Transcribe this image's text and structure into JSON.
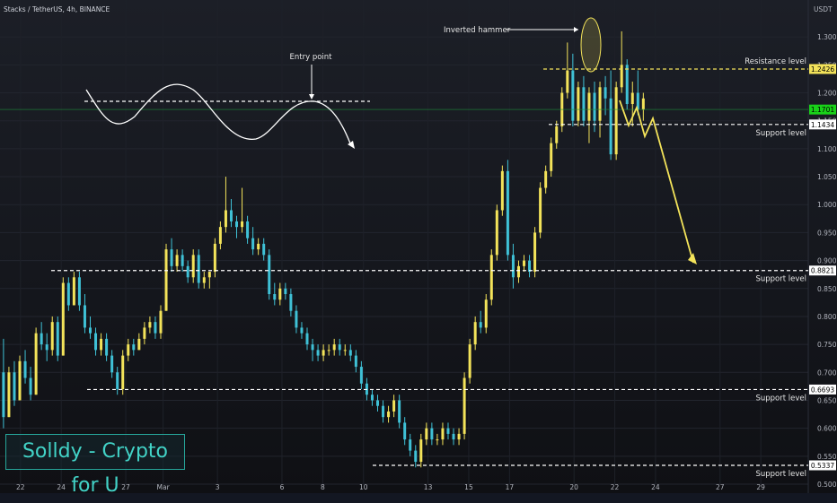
{
  "header": {
    "symbol_line": "Stacks / TetherUS, 4h, BINANCE",
    "quote_currency": "USDT"
  },
  "watermark": "Solldy - Crypto for U",
  "colors": {
    "bull": "#f3e35a",
    "bear": "#3fc1d6",
    "level_line": "#ffffff",
    "resistance_line": "#f3e35a",
    "projection": "#f3e35a",
    "price_tag": "#19d219",
    "background": "#131722"
  },
  "chart_data": {
    "type": "candlestick",
    "timeframe": "4h",
    "ylim": [
      0.5,
      1.35
    ],
    "y_ticks": [
      1.3,
      1.25,
      1.2,
      1.15,
      1.1,
      1.05,
      1.0,
      0.95,
      0.9,
      0.85,
      0.8,
      0.75,
      0.7,
      0.65,
      0.6,
      0.55,
      0.5
    ],
    "y_tick_labels": [
      "1.3000",
      "1.2500",
      "1.2000",
      "1.1500",
      "1.1000",
      "1.0500",
      "1.0000",
      "0.9500",
      "0.9000",
      "0.8500",
      "0.8000",
      "0.7500",
      "0.7000",
      "0.6500",
      "0.6000",
      "0.5500",
      "0.5000"
    ],
    "x_labels": [
      "22",
      "24",
      "27",
      "Mar",
      "3",
      "6",
      "8",
      "10",
      "13",
      "15",
      "17",
      "20",
      "22",
      "24",
      "27",
      "29"
    ],
    "x_label_index": [
      5,
      17,
      36,
      47,
      63,
      82,
      94,
      106,
      125,
      137,
      149,
      168,
      180,
      192,
      211,
      223
    ],
    "x_total_slots": 238,
    "candles": [
      [
        0.7,
        0.76,
        0.6,
        0.62
      ],
      [
        0.62,
        0.71,
        0.62,
        0.7
      ],
      [
        0.7,
        0.72,
        0.64,
        0.65
      ],
      [
        0.65,
        0.73,
        0.65,
        0.72
      ],
      [
        0.72,
        0.74,
        0.68,
        0.69
      ],
      [
        0.69,
        0.71,
        0.65,
        0.66
      ],
      [
        0.66,
        0.78,
        0.66,
        0.77
      ],
      [
        0.77,
        0.79,
        0.74,
        0.75
      ],
      [
        0.75,
        0.77,
        0.72,
        0.74
      ],
      [
        0.74,
        0.8,
        0.73,
        0.79
      ],
      [
        0.79,
        0.8,
        0.72,
        0.73
      ],
      [
        0.73,
        0.87,
        0.73,
        0.86
      ],
      [
        0.86,
        0.87,
        0.81,
        0.82
      ],
      [
        0.82,
        0.88,
        0.82,
        0.87
      ],
      [
        0.87,
        0.88,
        0.81,
        0.82
      ],
      [
        0.82,
        0.84,
        0.77,
        0.78
      ],
      [
        0.78,
        0.8,
        0.76,
        0.77
      ],
      [
        0.77,
        0.78,
        0.73,
        0.74
      ],
      [
        0.74,
        0.77,
        0.73,
        0.76
      ],
      [
        0.76,
        0.77,
        0.72,
        0.73
      ],
      [
        0.73,
        0.74,
        0.69,
        0.7
      ],
      [
        0.7,
        0.71,
        0.66,
        0.67
      ],
      [
        0.67,
        0.74,
        0.66,
        0.73
      ],
      [
        0.73,
        0.76,
        0.72,
        0.75
      ],
      [
        0.75,
        0.76,
        0.73,
        0.74
      ],
      [
        0.74,
        0.77,
        0.74,
        0.76
      ],
      [
        0.76,
        0.79,
        0.75,
        0.78
      ],
      [
        0.78,
        0.8,
        0.77,
        0.79
      ],
      [
        0.79,
        0.8,
        0.76,
        0.77
      ],
      [
        0.77,
        0.82,
        0.76,
        0.81
      ],
      [
        0.81,
        0.93,
        0.81,
        0.92
      ],
      [
        0.92,
        0.94,
        0.88,
        0.89
      ],
      [
        0.89,
        0.92,
        0.88,
        0.91
      ],
      [
        0.91,
        0.92,
        0.88,
        0.89
      ],
      [
        0.89,
        0.9,
        0.86,
        0.87
      ],
      [
        0.87,
        0.92,
        0.86,
        0.91
      ],
      [
        0.91,
        0.92,
        0.85,
        0.86
      ],
      [
        0.86,
        0.88,
        0.85,
        0.87
      ],
      [
        0.87,
        0.88,
        0.85,
        0.88
      ],
      [
        0.88,
        0.94,
        0.87,
        0.93
      ],
      [
        0.93,
        0.97,
        0.92,
        0.96
      ],
      [
        0.96,
        1.05,
        0.95,
        0.99
      ],
      [
        0.99,
        1.01,
        0.96,
        0.97
      ],
      [
        0.97,
        0.98,
        0.94,
        0.96
      ],
      [
        0.96,
        1.03,
        0.95,
        0.97
      ],
      [
        0.97,
        0.98,
        0.93,
        0.94
      ],
      [
        0.94,
        0.96,
        0.91,
        0.92
      ],
      [
        0.92,
        0.94,
        0.91,
        0.93
      ],
      [
        0.93,
        0.94,
        0.9,
        0.91
      ],
      [
        0.91,
        0.92,
        0.83,
        0.84
      ],
      [
        0.84,
        0.86,
        0.82,
        0.83
      ],
      [
        0.83,
        0.86,
        0.82,
        0.85
      ],
      [
        0.85,
        0.86,
        0.83,
        0.84
      ],
      [
        0.84,
        0.85,
        0.8,
        0.81
      ],
      [
        0.81,
        0.82,
        0.77,
        0.78
      ],
      [
        0.78,
        0.79,
        0.76,
        0.77
      ],
      [
        0.77,
        0.78,
        0.74,
        0.75
      ],
      [
        0.75,
        0.76,
        0.72,
        0.74
      ],
      [
        0.74,
        0.75,
        0.72,
        0.73
      ],
      [
        0.73,
        0.75,
        0.72,
        0.74
      ],
      [
        0.74,
        0.75,
        0.73,
        0.74
      ],
      [
        0.74,
        0.76,
        0.73,
        0.75
      ],
      [
        0.75,
        0.76,
        0.73,
        0.74
      ],
      [
        0.74,
        0.75,
        0.73,
        0.74
      ],
      [
        0.74,
        0.75,
        0.72,
        0.73
      ],
      [
        0.73,
        0.74,
        0.7,
        0.71
      ],
      [
        0.71,
        0.72,
        0.67,
        0.68
      ],
      [
        0.68,
        0.69,
        0.65,
        0.66
      ],
      [
        0.66,
        0.67,
        0.64,
        0.65
      ],
      [
        0.65,
        0.66,
        0.63,
        0.64
      ],
      [
        0.64,
        0.65,
        0.61,
        0.62
      ],
      [
        0.62,
        0.64,
        0.61,
        0.63
      ],
      [
        0.63,
        0.66,
        0.62,
        0.65
      ],
      [
        0.65,
        0.66,
        0.6,
        0.61
      ],
      [
        0.61,
        0.62,
        0.57,
        0.58
      ],
      [
        0.58,
        0.59,
        0.55,
        0.56
      ],
      [
        0.56,
        0.57,
        0.53,
        0.54
      ],
      [
        0.54,
        0.59,
        0.53,
        0.58
      ],
      [
        0.58,
        0.61,
        0.57,
        0.6
      ],
      [
        0.6,
        0.61,
        0.57,
        0.58
      ],
      [
        0.58,
        0.59,
        0.57,
        0.58
      ],
      [
        0.58,
        0.61,
        0.57,
        0.6
      ],
      [
        0.6,
        0.61,
        0.58,
        0.59
      ],
      [
        0.59,
        0.6,
        0.57,
        0.58
      ],
      [
        0.58,
        0.6,
        0.57,
        0.59
      ],
      [
        0.59,
        0.7,
        0.58,
        0.69
      ],
      [
        0.69,
        0.76,
        0.68,
        0.75
      ],
      [
        0.75,
        0.8,
        0.74,
        0.79
      ],
      [
        0.79,
        0.81,
        0.77,
        0.78
      ],
      [
        0.78,
        0.84,
        0.77,
        0.83
      ],
      [
        0.83,
        0.92,
        0.82,
        0.91
      ],
      [
        0.91,
        1.0,
        0.9,
        0.99
      ],
      [
        0.99,
        1.07,
        0.98,
        1.06
      ],
      [
        1.06,
        1.08,
        0.9,
        0.91
      ],
      [
        0.91,
        0.93,
        0.85,
        0.87
      ],
      [
        0.87,
        0.9,
        0.86,
        0.89
      ],
      [
        0.89,
        0.91,
        0.88,
        0.9
      ],
      [
        0.9,
        0.91,
        0.87,
        0.88
      ],
      [
        0.88,
        0.96,
        0.87,
        0.95
      ],
      [
        0.95,
        1.04,
        0.94,
        1.03
      ],
      [
        1.03,
        1.07,
        1.02,
        1.06
      ],
      [
        1.06,
        1.12,
        1.05,
        1.11
      ],
      [
        1.11,
        1.15,
        1.1,
        1.14
      ],
      [
        1.14,
        1.21,
        1.13,
        1.2
      ],
      [
        1.2,
        1.29,
        1.19,
        1.24
      ],
      [
        1.24,
        1.27,
        1.14,
        1.15
      ],
      [
        1.15,
        1.22,
        1.14,
        1.21
      ],
      [
        1.21,
        1.23,
        1.14,
        1.15
      ],
      [
        1.15,
        1.21,
        1.11,
        1.2
      ],
      [
        1.2,
        1.22,
        1.13,
        1.15
      ],
      [
        1.15,
        1.22,
        1.12,
        1.21
      ],
      [
        1.21,
        1.23,
        1.16,
        1.19
      ],
      [
        1.19,
        1.24,
        1.08,
        1.09
      ],
      [
        1.09,
        1.22,
        1.08,
        1.21
      ],
      [
        1.21,
        1.31,
        1.2,
        1.25
      ],
      [
        1.25,
        1.26,
        1.17,
        1.18
      ],
      [
        1.18,
        1.22,
        1.14,
        1.2
      ],
      [
        1.2,
        1.24,
        1.16,
        1.17
      ],
      [
        1.17,
        1.2,
        1.15,
        1.19
      ]
    ],
    "candle_slot_map": [
      0,
      1,
      2,
      3,
      4,
      5,
      6,
      7,
      8,
      9,
      10,
      11,
      12,
      13,
      14,
      15,
      16,
      17,
      18,
      19,
      20,
      21,
      22,
      23,
      24,
      25,
      26,
      27,
      28,
      29,
      30,
      31,
      32,
      33,
      34,
      35,
      36,
      37,
      38,
      39,
      40,
      41,
      42,
      43,
      44,
      45,
      46,
      47,
      48,
      49,
      50,
      51,
      52,
      53,
      54,
      55,
      56,
      57,
      58,
      59,
      60,
      61,
      62,
      63,
      64,
      65,
      66,
      67,
      68,
      69,
      70,
      71,
      72,
      73,
      74,
      75,
      76,
      77,
      78,
      79,
      80,
      81,
      82,
      83,
      84,
      85,
      86,
      87,
      88,
      89,
      90,
      91,
      92,
      93,
      94,
      95,
      96,
      97,
      98,
      99,
      100,
      101,
      102,
      103,
      104,
      105,
      106,
      107,
      108,
      109,
      110,
      111,
      112,
      113,
      114,
      115,
      116,
      117,
      118,
      119
    ],
    "horizontal_levels": [
      {
        "name": "Resistance level",
        "value": 1.2426,
        "tag": "1.2426",
        "kind": "resistance"
      },
      {
        "name": "current-price",
        "value": 1.1701,
        "tag": "1.1701",
        "kind": "price"
      },
      {
        "name": "Support level",
        "value": 1.1434,
        "tag": "1.1434",
        "kind": "support"
      },
      {
        "name": "Support level",
        "value": 0.8821,
        "tag": "0.8821",
        "kind": "support"
      },
      {
        "name": "Support level",
        "value": 0.6693,
        "tag": "0.6693",
        "kind": "support"
      },
      {
        "name": "Support level",
        "value": 0.5337,
        "tag": "0.5337",
        "kind": "support"
      }
    ],
    "annotations": {
      "inverted_hammer": "Inverted hammer",
      "entry_point": "Entry point",
      "resistance_label": "Resistance level",
      "support_label": "Support level"
    }
  }
}
